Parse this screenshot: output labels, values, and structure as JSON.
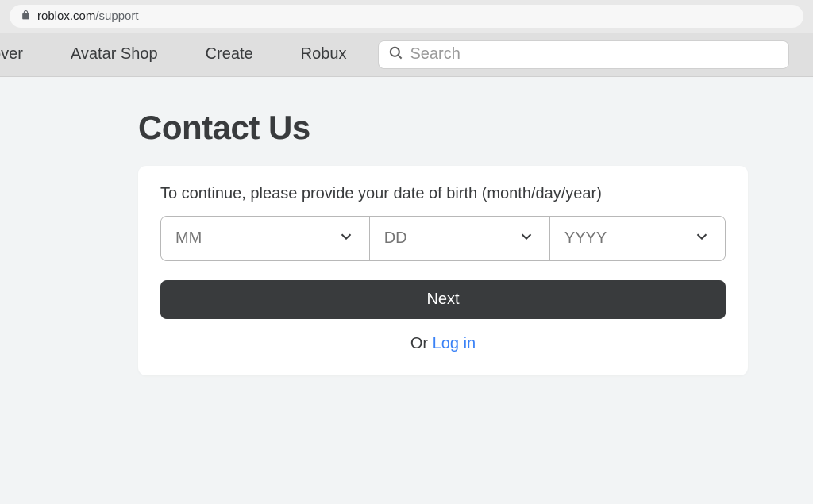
{
  "browser": {
    "domain": "roblox.com",
    "path": "/support"
  },
  "nav": {
    "links": [
      "cover",
      "Avatar Shop",
      "Create",
      "Robux"
    ],
    "search_placeholder": "Search"
  },
  "page": {
    "title": "Contact Us",
    "prompt": "To continue, please provide your date of birth (month/day/year)",
    "dob": {
      "month": "MM",
      "day": "DD",
      "year": "YYYY"
    },
    "next_label": "Next",
    "or_label": "Or ",
    "login_label": "Log in"
  }
}
